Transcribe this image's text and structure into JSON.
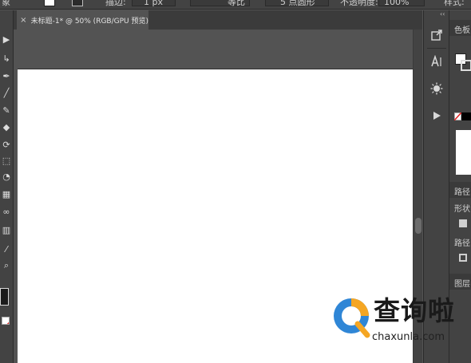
{
  "control_bar": {
    "left_label": "象",
    "stroke_label": "描边:",
    "stroke_value": "1 px",
    "profile_label": "等比",
    "brush_label": "5 点圆形",
    "opacity_label": "不透明度:",
    "opacity_value": "100%",
    "style_label": "样式:"
  },
  "document": {
    "tab_close": "×",
    "tab_title": "未标题-1* @ 50% (RGB/GPU 预览)"
  },
  "dock": {
    "collapse_glyph": "‹‹"
  },
  "right_panel": {
    "color_label": "色板",
    "path_label": "路径",
    "shape_label": "形状",
    "path_label_2": "路径",
    "layers_label": "图层"
  },
  "tools": [
    {
      "name": "selection-tool-icon",
      "glyph": "▶"
    },
    {
      "name": "direct-selection-tool-icon",
      "glyph": "↳"
    },
    {
      "name": "pen-tool-icon",
      "glyph": "✒"
    },
    {
      "name": "line-tool-icon",
      "glyph": "╱"
    },
    {
      "name": "brush-tool-icon",
      "glyph": "✎"
    },
    {
      "name": "eraser-tool-icon",
      "glyph": "◆"
    },
    {
      "name": "rotate-tool-icon",
      "glyph": "⟳"
    },
    {
      "name": "free-transform-tool-icon",
      "glyph": "⬚"
    },
    {
      "name": "shape-builder-tool-icon",
      "glyph": "◔"
    },
    {
      "name": "gradient-tool-icon",
      "glyph": "▦"
    },
    {
      "name": "blend-tool-icon",
      "glyph": "∞"
    },
    {
      "name": "graph-tool-icon",
      "glyph": "▥"
    },
    {
      "name": "eyedropper-tool-icon",
      "glyph": "⁄"
    },
    {
      "name": "zoom-tool-icon",
      "glyph": "⌕"
    }
  ],
  "watermark": {
    "main": "查询啦",
    "sub": "chaxunla.com"
  },
  "colors": {
    "ui_background": "#535353",
    "panel": "#434343",
    "artboard": "#ffffff",
    "watermark_orange": "#f5a623",
    "watermark_blue": "#2f86d6"
  }
}
